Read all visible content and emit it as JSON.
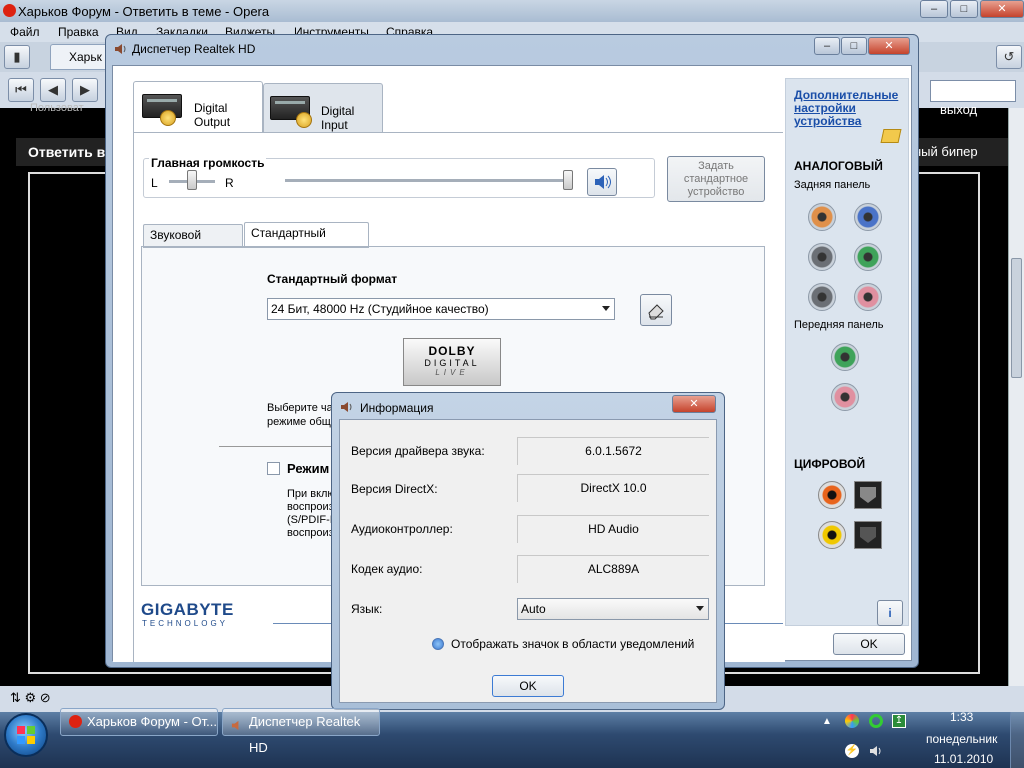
{
  "opera": {
    "title": "Харьков Форум - Ответить в теме - Opera",
    "menu": [
      "Файл",
      "Правка",
      "Вид",
      "Закладки",
      "Виджеты",
      "Инструменты",
      "Справка"
    ],
    "tab_label": "Харьк",
    "page_left_hint": "Пользоват",
    "page_right_hint": "выход",
    "reply_heading": "Ответить в",
    "right_text": "ный бипер"
  },
  "realtek": {
    "title": "Диспетчер Realtek HD",
    "device_tabs": {
      "output": "Digital Output",
      "input": "Digital Input"
    },
    "volume": {
      "label": "Главная громкость",
      "left": "L",
      "right": "R"
    },
    "set_default_btn": "Задать стандартное устройство",
    "subtabs": {
      "effect": "Звуковой эффект",
      "format": "Стандартный формат"
    },
    "format_heading": "Стандартный формат",
    "format_value": "24 Бит, 48000 Hz (Студийное качество)",
    "dolby": {
      "line1": "DOLBY",
      "line2": "DIGITAL",
      "line3": "LIVE"
    },
    "hint_text_l1": "Выберите ча",
    "hint_text_l2": "режиме обще",
    "mode_label": "Режим",
    "mode_desc": [
      "При вклю",
      "воспроиз",
      "(S/PDIF-I",
      "воспроиз"
    ],
    "right_panel": {
      "link": "Дополнительные настройки устройства",
      "analog": "АНАЛОГОВЫЙ",
      "back_panel": "Задняя панель",
      "front_panel": "Передняя панель",
      "digital": "ЦИФРОВОЙ"
    },
    "brand": {
      "name": "GIGABYTE",
      "sub": "TECHNOLOGY"
    },
    "ok": "OK"
  },
  "info": {
    "title": "Информация",
    "rows": [
      {
        "label": "Версия драйвера звука:",
        "value": "6.0.1.5672"
      },
      {
        "label": "Версия DirectX:",
        "value": "DirectX 10.0"
      },
      {
        "label": "Аудиоконтроллер:",
        "value": "HD Audio"
      },
      {
        "label": "Кодек аудио:",
        "value": "ALC889A"
      }
    ],
    "language_label": "Язык:",
    "language_value": "Auto",
    "tray_checkbox": "Отображать значок в области уведомлений",
    "ok": "OK"
  },
  "taskbar": {
    "items": [
      "Харьков Форум - От...",
      "Диспетчер Realtek HD"
    ],
    "time": "1:33",
    "day": "понедельник",
    "date": "11.01.2010"
  },
  "colors": {
    "jack_orange": "#e0904a",
    "jack_blue": "#4a73c8",
    "jack_gray": "#6b6f75",
    "jack_green": "#3fa35a",
    "jack_pink": "#e090a0",
    "link_blue": "#1a4ea8"
  }
}
